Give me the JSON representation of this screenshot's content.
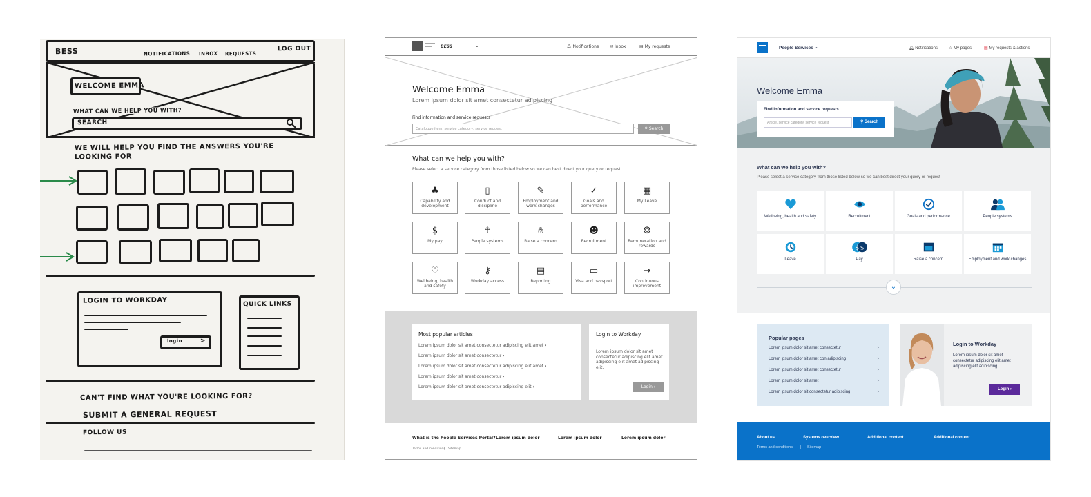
{
  "sketch": {
    "brand": "BESS",
    "nav": [
      "NOTIFICATIONS",
      "INBOX",
      "REQUESTS"
    ],
    "logout": "LOG OUT",
    "welcome": "WELCOME EMMA",
    "question": "WHAT CAN WE HELP YOU WITH?",
    "search": "SEARCH",
    "help_line1": "WE WILL HELP YOU FIND THE ANSWERS YOU'RE",
    "help_line2": "LOOKING FOR",
    "login_title": "LOGIN TO WORKDAY",
    "login_btn": "login",
    "quick_links": "QUICK LINKS",
    "cant_find": "CAN'T FIND WHAT YOU'RE LOOKING FOR?",
    "submit": "SUBMIT A GENERAL REQUEST",
    "follow": "FOLLOW US"
  },
  "wire": {
    "brand": "BESS",
    "nav": {
      "notifications": "Notifications",
      "inbox": "Inbox",
      "requests": "My requests"
    },
    "welcome": "Welcome Emma",
    "tagline": "Lorem ipsum dolor sit amet consectetur adipiscing",
    "find_label": "Find information and service requests",
    "search_placeholder": "Catalogue item, service category, service request",
    "search_btn": "Search",
    "help_title": "What can we help you with?",
    "help_sub": "Please select a service category from those listed below so we can best direct your query or request",
    "tiles": [
      {
        "label": "Capability and development",
        "icon": "plant-icon"
      },
      {
        "label": "Conduct and discipline",
        "icon": "clipboard-icon"
      },
      {
        "label": "Employment and work changes",
        "icon": "edit-icon"
      },
      {
        "label": "Goals and performance",
        "icon": "check-circle-icon"
      },
      {
        "label": "My Leave",
        "icon": "calendar-icon"
      },
      {
        "label": "My pay",
        "icon": "dollar-icon"
      },
      {
        "label": "People systems",
        "icon": "person-icon"
      },
      {
        "label": "Raise a concern",
        "icon": "hand-icon"
      },
      {
        "label": "Recruitment",
        "icon": "user-check-icon"
      },
      {
        "label": "Remuneration and rewards",
        "icon": "award-icon"
      },
      {
        "label": "Wellbeing, health and safety",
        "icon": "heart-icon"
      },
      {
        "label": "Workday access",
        "icon": "key-icon"
      },
      {
        "label": "Reporting",
        "icon": "document-icon"
      },
      {
        "label": "Visa and passport",
        "icon": "id-card-icon"
      },
      {
        "label": "Continuous improvement",
        "icon": "arrow-right-icon"
      }
    ],
    "articles_title": "Most popular articles",
    "articles": [
      "Lorem ipsum dolor sit amet consectetur adipiscing elit amet",
      "Lorem ipsum dolor sit amet consectetur",
      "Lorem ipsum dolor sit amet consectetur adipiscing elit amet",
      "Lorem ipsum dolor sit amet consectetur",
      "Lorem ipsum dolor sit amet consectetur adipiscing elit"
    ],
    "login_title": "Login to Workday",
    "login_text": "Lorem ipsum dolor sit amet consectetur adipiscing elit amet adipiscing elit amet adipiscing elit.",
    "login_btn": "Login",
    "footer_cols": [
      "What is the People Services Portal?",
      "Lorem ipsum dolor",
      "Lorem ipsum dolor",
      "Lorem ipsum dolor"
    ],
    "footer_links": [
      "Terms and conditions",
      "Sitemap"
    ]
  },
  "hifi": {
    "brand": "People Services",
    "nav": {
      "notifications": "Notifications",
      "pages": "My pages",
      "requests": "My requests & actions"
    },
    "welcome": "Welcome Emma",
    "find_label": "Find information and service requests",
    "search_placeholder": "Article, service category, service request",
    "search_btn": "Search",
    "help_title": "What can we help you with?",
    "help_sub": "Please select a service category from those listed below so we can best direct your query or request",
    "tiles": [
      {
        "label": "Wellbeing, health and safety",
        "icon": "heart-icon"
      },
      {
        "label": "Recruitment",
        "icon": "eye-icon"
      },
      {
        "label": "Goals and performance",
        "icon": "check-circle-icon"
      },
      {
        "label": "People systems",
        "icon": "people-icon"
      },
      {
        "label": "Leave",
        "icon": "clock-icon"
      },
      {
        "label": "Pay",
        "icon": "dollar-coins-icon"
      },
      {
        "label": "Raise a concern",
        "icon": "window-icon"
      },
      {
        "label": "Employment and work changes",
        "icon": "calendar-icon"
      }
    ],
    "popular_title": "Popular pages",
    "popular": [
      "Lorem ipsum dolor sit amet consectetur",
      "Lorem ipsum dolor sit amet con adipiscing",
      "Lorem ipsum dolor sit amet consectetur",
      "Lorem ipsum dolor sit amet",
      "Lorem ipsum dolor sit consectetur adipiscing"
    ],
    "login_title": "Login to Workday",
    "login_text": "Lorem ipsum dolor sit amet consectetur adipiscing elit amet adipiscing elit adipiscing",
    "login_btn": "Login",
    "footer_cols": [
      "About us",
      "Systems overview",
      "Additional content",
      "Additional content"
    ],
    "footer_links": [
      "Terms and conditions",
      "Sitemap"
    ],
    "colors": {
      "primary": "#0a72c9",
      "login": "#5b2a9b",
      "accent": "#1a9ad6"
    }
  }
}
